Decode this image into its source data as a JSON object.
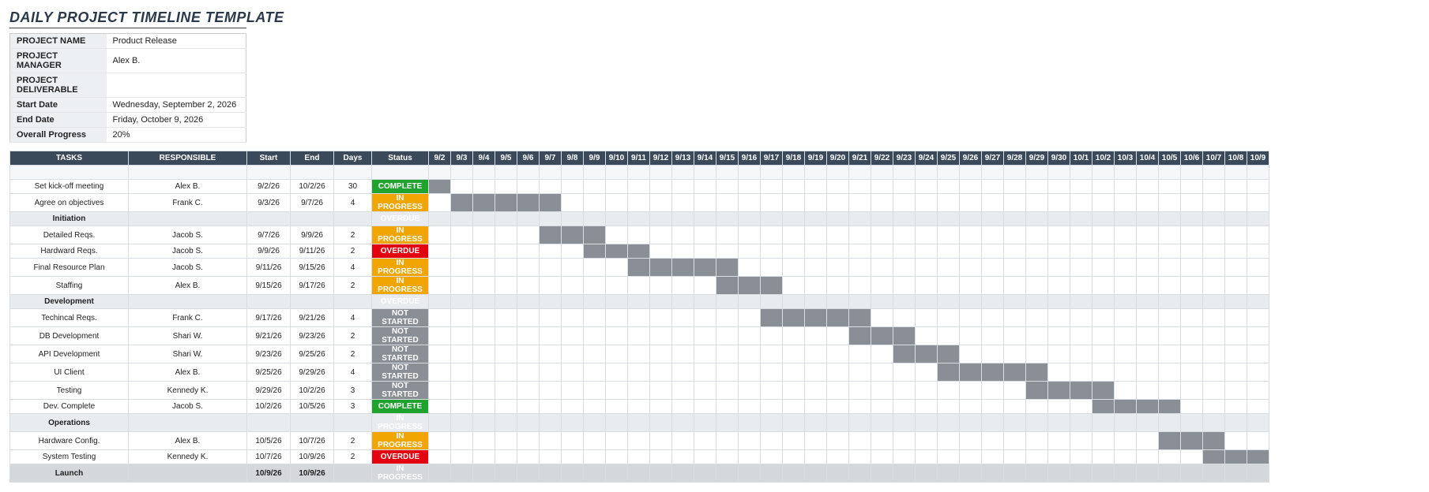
{
  "title": "DAILY PROJECT TIMELINE TEMPLATE",
  "meta": {
    "labels": {
      "name": "PROJECT NAME",
      "manager": "PROJECT MANAGER",
      "deliverable": "PROJECT DELIVERABLE",
      "start": "Start Date",
      "end": "End Date",
      "progress": "Overall Progress"
    },
    "values": {
      "name": "Product Release",
      "manager": "Alex B.",
      "deliverable": "",
      "start": "Wednesday, September 2, 2026",
      "end": "Friday, October 9, 2026",
      "progress": "20%"
    }
  },
  "columns": {
    "tasks": "TASKS",
    "responsible": "RESPONSIBLE",
    "start": "Start",
    "end": "End",
    "days": "Days",
    "status": "Status"
  },
  "dates": [
    "9/2",
    "9/3",
    "9/4",
    "9/5",
    "9/6",
    "9/7",
    "9/8",
    "9/9",
    "9/10",
    "9/11",
    "9/12",
    "9/13",
    "9/14",
    "9/15",
    "9/16",
    "9/17",
    "9/18",
    "9/19",
    "9/20",
    "9/21",
    "9/22",
    "9/23",
    "9/24",
    "9/25",
    "9/26",
    "9/27",
    "9/28",
    "9/29",
    "9/30",
    "10/1",
    "10/2",
    "10/3",
    "10/4",
    "10/5",
    "10/6",
    "10/7",
    "10/8",
    "10/9"
  ],
  "rows": [
    {
      "type": "blank"
    },
    {
      "type": "task",
      "task": "Set kick-off meeting",
      "resp": "Alex B.",
      "start": "9/2/26",
      "end": "10/2/26",
      "days": "30",
      "status": "COMPLETE",
      "statusClass": "s-complete",
      "bar": [
        0,
        0
      ]
    },
    {
      "type": "task",
      "task": "Agree on objectives",
      "resp": "Frank C.",
      "start": "9/3/26",
      "end": "9/7/26",
      "days": "4",
      "status": "IN PROGRESS",
      "statusClass": "s-inprogress",
      "bar": [
        1,
        5
      ]
    },
    {
      "type": "section",
      "task": "Initiation",
      "status": "OVERDUE",
      "statusClass": "s-overdue"
    },
    {
      "type": "task",
      "task": "Detailed Reqs.",
      "resp": "Jacob S.",
      "start": "9/7/26",
      "end": "9/9/26",
      "days": "2",
      "status": "IN PROGRESS",
      "statusClass": "s-inprogress",
      "bar": [
        5,
        7
      ]
    },
    {
      "type": "task",
      "task": "Hardward Reqs.",
      "resp": "Jacob S.",
      "start": "9/9/26",
      "end": "9/11/26",
      "days": "2",
      "status": "OVERDUE",
      "statusClass": "s-overdue",
      "bar": [
        7,
        9
      ]
    },
    {
      "type": "task",
      "task": "Final Resource Plan",
      "resp": "Jacob S.",
      "start": "9/11/26",
      "end": "9/15/26",
      "days": "4",
      "status": "IN PROGRESS",
      "statusClass": "s-inprogress",
      "bar": [
        9,
        13
      ]
    },
    {
      "type": "task",
      "task": "Staffing",
      "resp": "Alex B.",
      "start": "9/15/26",
      "end": "9/17/26",
      "days": "2",
      "status": "IN PROGRESS",
      "statusClass": "s-inprogress",
      "bar": [
        13,
        15
      ]
    },
    {
      "type": "section",
      "task": "Development",
      "status": "OVERDUE",
      "statusClass": "s-overdue"
    },
    {
      "type": "task",
      "task": "Techincal Reqs.",
      "resp": "Frank C.",
      "start": "9/17/26",
      "end": "9/21/26",
      "days": "4",
      "status": "NOT STARTED",
      "statusClass": "s-notstarted",
      "bar": [
        15,
        19
      ]
    },
    {
      "type": "task",
      "task": "DB Development",
      "resp": "Shari W.",
      "start": "9/21/26",
      "end": "9/23/26",
      "days": "2",
      "status": "NOT STARTED",
      "statusClass": "s-notstarted",
      "bar": [
        19,
        21
      ]
    },
    {
      "type": "task",
      "task": "API Development",
      "resp": "Shari W.",
      "start": "9/23/26",
      "end": "9/25/26",
      "days": "2",
      "status": "NOT STARTED",
      "statusClass": "s-notstarted",
      "bar": [
        21,
        23
      ]
    },
    {
      "type": "task",
      "task": "UI Client",
      "resp": "Alex B.",
      "start": "9/25/26",
      "end": "9/29/26",
      "days": "4",
      "status": "NOT STARTED",
      "statusClass": "s-notstarted",
      "bar": [
        23,
        27
      ]
    },
    {
      "type": "task",
      "task": "Testing",
      "resp": "Kennedy K.",
      "start": "9/29/26",
      "end": "10/2/26",
      "days": "3",
      "status": "NOT STARTED",
      "statusClass": "s-notstarted",
      "bar": [
        27,
        30
      ]
    },
    {
      "type": "task",
      "task": "Dev. Complete",
      "resp": "Jacob S.",
      "start": "10/2/26",
      "end": "10/5/26",
      "days": "3",
      "status": "COMPLETE",
      "statusClass": "s-complete",
      "bar": [
        30,
        33
      ]
    },
    {
      "type": "section",
      "task": "Operations",
      "status": "IN PROGRESS",
      "statusClass": "s-inprogress"
    },
    {
      "type": "task",
      "task": "Hardware Config.",
      "resp": "Alex B.",
      "start": "10/5/26",
      "end": "10/7/26",
      "days": "2",
      "status": "IN PROGRESS",
      "statusClass": "s-inprogress",
      "bar": [
        33,
        35
      ]
    },
    {
      "type": "task",
      "task": "System Testing",
      "resp": "Kennedy K.",
      "start": "10/7/26",
      "end": "10/9/26",
      "days": "2",
      "status": "OVERDUE",
      "statusClass": "s-overdue",
      "bar": [
        35,
        37
      ]
    },
    {
      "type": "launch",
      "task": "Launch",
      "start": "10/9/26",
      "end": "10/9/26",
      "status": "IN PROGRESS",
      "statusClass": "s-inprogress"
    }
  ]
}
